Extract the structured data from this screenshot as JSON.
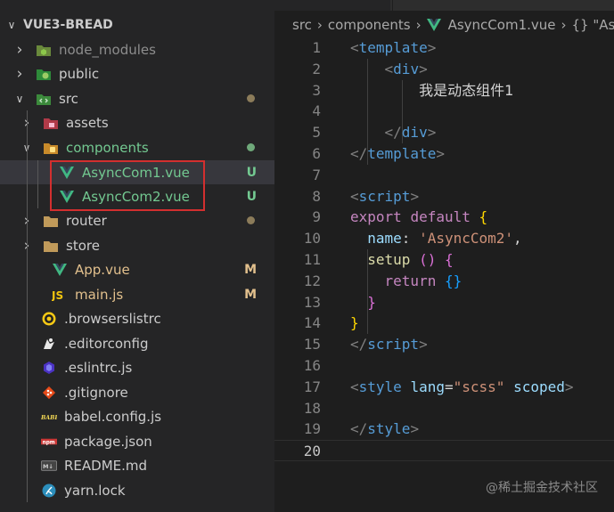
{
  "explorer": {
    "root_label": "VUE3-BREAD",
    "items": [
      {
        "label": "node_modules",
        "chevron": ">",
        "icon": "node-modules-folder-icon",
        "color": "#8d8d8d"
      },
      {
        "label": "public",
        "chevron": ">",
        "icon": "public-folder-icon",
        "color": "#cccccc"
      },
      {
        "label": "src",
        "chevron": "v",
        "icon": "src-folder-icon",
        "color": "#cccccc",
        "status_color": "#8c7c5a"
      },
      {
        "label": "assets",
        "chevron": ">",
        "icon": "assets-folder-icon",
        "color": "#cccccc"
      },
      {
        "label": "components",
        "chevron": "v",
        "icon": "components-folder-icon",
        "color": "#73c991",
        "status_color": "#6fa97a"
      },
      {
        "label": "AsyncCom1.vue",
        "icon": "vue-file-icon",
        "color": "#73c991",
        "badge": "U"
      },
      {
        "label": "AsyncCom2.vue",
        "icon": "vue-file-icon",
        "color": "#73c991",
        "badge": "U"
      },
      {
        "label": "router",
        "chevron": ">",
        "icon": "router-folder-icon",
        "color": "#cccccc",
        "status_color": "#8c7c5a"
      },
      {
        "label": "store",
        "chevron": ">",
        "icon": "store-folder-icon",
        "color": "#cccccc"
      },
      {
        "label": "App.vue",
        "icon": "vue-file-icon",
        "color": "#e2c08d",
        "badge": "M"
      },
      {
        "label": "main.js",
        "icon": "js-file-icon",
        "color": "#e2c08d",
        "badge": "M"
      },
      {
        "label": ".browserslistrc",
        "icon": "browserslist-icon",
        "color": "#cccccc"
      },
      {
        "label": ".editorconfig",
        "icon": "editorconfig-icon",
        "color": "#cccccc"
      },
      {
        "label": ".eslintrc.js",
        "icon": "eslint-icon",
        "color": "#cccccc"
      },
      {
        "label": ".gitignore",
        "icon": "git-icon",
        "color": "#cccccc"
      },
      {
        "label": "babel.config.js",
        "icon": "babel-icon",
        "color": "#cccccc"
      },
      {
        "label": "package.json",
        "icon": "npm-icon",
        "color": "#cccccc"
      },
      {
        "label": "README.md",
        "icon": "markdown-icon",
        "color": "#cccccc"
      },
      {
        "label": "yarn.lock",
        "icon": "yarn-icon",
        "color": "#cccccc"
      }
    ]
  },
  "breadcrumb": {
    "parts": [
      "src",
      "components",
      "AsyncCom1.vue",
      "{} \"Asy"
    ]
  },
  "editor": {
    "line_numbers": [
      "1",
      "2",
      "3",
      "4",
      "5",
      "6",
      "7",
      "8",
      "9",
      "10",
      "11",
      "12",
      "13",
      "14",
      "15",
      "16",
      "17",
      "18",
      "19",
      "20"
    ],
    "current_line": "20"
  },
  "watermark": "@稀土掘金技术社区",
  "colors": {
    "untracked": "#73c991",
    "modified": "#e2c08d",
    "highlight_box": "#d32f2f",
    "vue_green": "#41b883"
  }
}
